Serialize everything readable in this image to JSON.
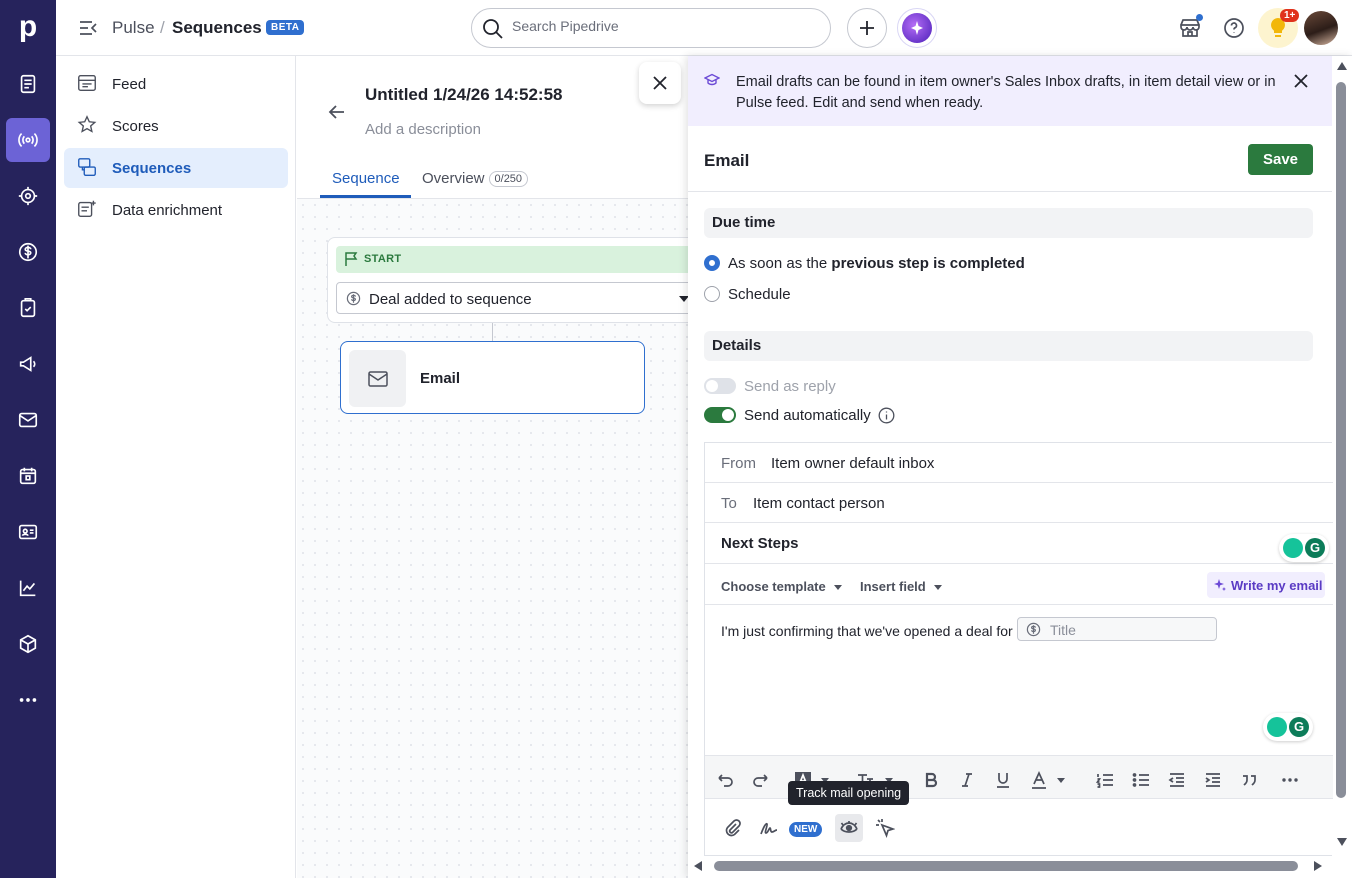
{
  "rail": {
    "logo": "p",
    "items": [
      "deals-icon",
      "pulse-icon",
      "leads-icon",
      "money-icon",
      "activities-icon",
      "campaigns-icon",
      "mail-icon",
      "calendar-icon",
      "contacts-icon",
      "insights-icon",
      "products-icon",
      "more-icon"
    ]
  },
  "header": {
    "crumb_parent": "Pulse",
    "crumb_sep": "/",
    "crumb_current": "Sequences",
    "beta": "BETA",
    "search_placeholder": "Search Pipedrive",
    "notif_count": "1+"
  },
  "subnav": {
    "items": [
      {
        "label": "Feed"
      },
      {
        "label": "Scores"
      },
      {
        "label": "Sequences"
      },
      {
        "label": "Data enrichment"
      }
    ]
  },
  "sequence": {
    "title": "Untitled 1/24/26 14:52:58",
    "description_placeholder": "Add a description",
    "tab_sequence": "Sequence",
    "tab_overview": "Overview",
    "overview_count": "0/250",
    "start_label": "START",
    "trigger": "Deal added to sequence",
    "email_node": "Email"
  },
  "panel": {
    "banner": "Email drafts can be found in item owner's Sales Inbox drafts, in item detail view or in Pulse feed. Edit and send when ready.",
    "title": "Email",
    "save": "Save",
    "due_time": "Due time",
    "opt1_prefix": "As soon as the ",
    "opt1_bold": "previous step is completed",
    "opt2": "Schedule",
    "details": "Details",
    "send_as_reply": "Send as reply",
    "send_automatically": "Send automatically",
    "from_label": "From",
    "from_value": "Item owner default inbox",
    "to_label": "To",
    "to_value": "Item contact person",
    "subject": "Next Steps",
    "choose_template": "Choose template",
    "insert_field": "Insert field",
    "write_my_email": "Write my email",
    "body_text": "I'm just confirming that we've opened a deal for",
    "field_chip": "Title",
    "tooltip": "Track mail opening",
    "new_badge": "NEW"
  },
  "colors": {
    "rail": "#26235c",
    "accent": "#2f6fcf",
    "save": "#2b7a3e",
    "banner": "#f1eefe"
  }
}
